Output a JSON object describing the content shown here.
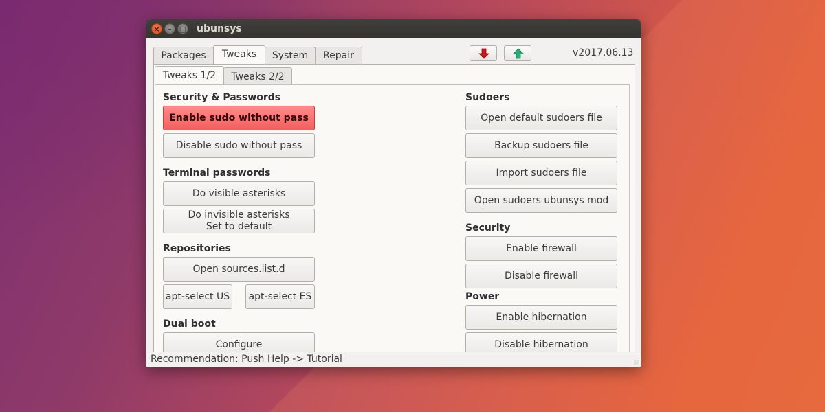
{
  "window": {
    "title": "ubunsys",
    "controls": {
      "close": "×",
      "minimize": "–",
      "maximize": "□"
    }
  },
  "main_tabs": [
    {
      "label": "Packages",
      "active": false
    },
    {
      "label": "Tweaks",
      "active": true
    },
    {
      "label": "System",
      "active": false
    },
    {
      "label": "Repair",
      "active": false
    }
  ],
  "toolbar": {
    "down_arrow_icon": "arrow-down-red",
    "up_arrow_icon": "arrow-up-green",
    "down_color": "#c8161b",
    "up_color": "#21b27a",
    "version": "v2017.06.13"
  },
  "sub_tabs": [
    {
      "label": "Tweaks 1/2",
      "active": true
    },
    {
      "label": "Tweaks 2/2",
      "active": false
    }
  ],
  "left": {
    "security": {
      "heading": "Security & Passwords",
      "enable_sudo": "Enable sudo without pass",
      "disable_sudo": "Disable sudo without pass"
    },
    "terminal": {
      "heading": "Terminal passwords",
      "visible": "Do visible asterisks",
      "invisible_line1": "Do invisible asterisks",
      "invisible_line2": "Set to default"
    },
    "repos": {
      "heading": "Repositories",
      "open_sources": "Open sources.list.d",
      "apt_us": "apt-select US",
      "apt_es": "apt-select ES"
    },
    "dualboot": {
      "heading": "Dual boot",
      "configure": "Configure"
    }
  },
  "right": {
    "sudoers": {
      "heading": "Sudoers",
      "open_default": "Open default sudoers file",
      "backup": "Backup sudoers file",
      "import": "Import sudoers file",
      "open_mod": "Open sudoers ubunsys mod"
    },
    "security": {
      "heading": "Security",
      "enable_fw": "Enable firewall",
      "disable_fw": "Disable firewall"
    },
    "power": {
      "heading": "Power",
      "enable_hib": "Enable hibernation",
      "disable_hib": "Disable hibernation"
    }
  },
  "status": {
    "text": "Recommendation: Push Help -> Tutorial"
  },
  "colors": {
    "accent_red": "#f45f5f",
    "titlebar": "#3b3a36"
  }
}
